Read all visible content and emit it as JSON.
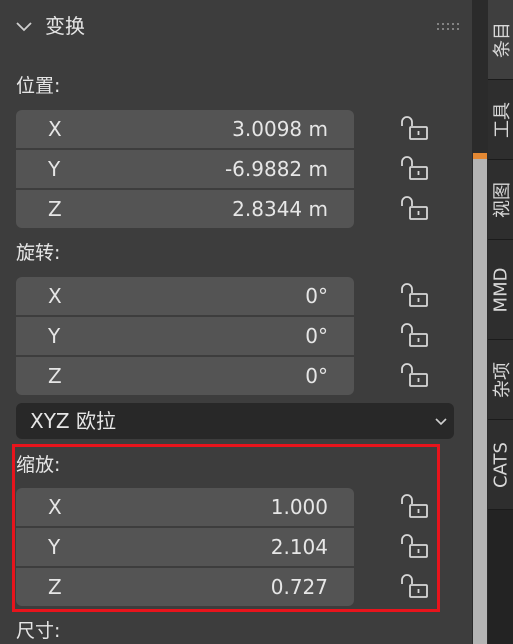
{
  "panel": {
    "title": "变换",
    "icons": {
      "collapse": "chevron-down-icon",
      "drag": "drag-grip-icon",
      "lock": "unlocked-lock-icon"
    }
  },
  "location": {
    "label": "位置:",
    "rows": [
      {
        "axis": "X",
        "value": "3.0098 m"
      },
      {
        "axis": "Y",
        "value": "-6.9882 m"
      },
      {
        "axis": "Z",
        "value": "2.8344 m"
      }
    ]
  },
  "rotation": {
    "label": "旋转:",
    "rows": [
      {
        "axis": "X",
        "value": "0°"
      },
      {
        "axis": "Y",
        "value": "0°"
      },
      {
        "axis": "Z",
        "value": "0°"
      }
    ],
    "mode": "XYZ 欧拉"
  },
  "scale": {
    "label": "缩放:",
    "rows": [
      {
        "axis": "X",
        "value": "1.000"
      },
      {
        "axis": "Y",
        "value": "2.104"
      },
      {
        "axis": "Z",
        "value": "0.727"
      }
    ]
  },
  "dimensions": {
    "label": "尺寸:"
  },
  "tabs": [
    "条目",
    "工具",
    "视图",
    "MMD",
    "杂项",
    "CATS"
  ],
  "colors": {
    "highlight": "#e8141c",
    "scroll_accent": "#e38833",
    "field_bg": "#545454"
  }
}
